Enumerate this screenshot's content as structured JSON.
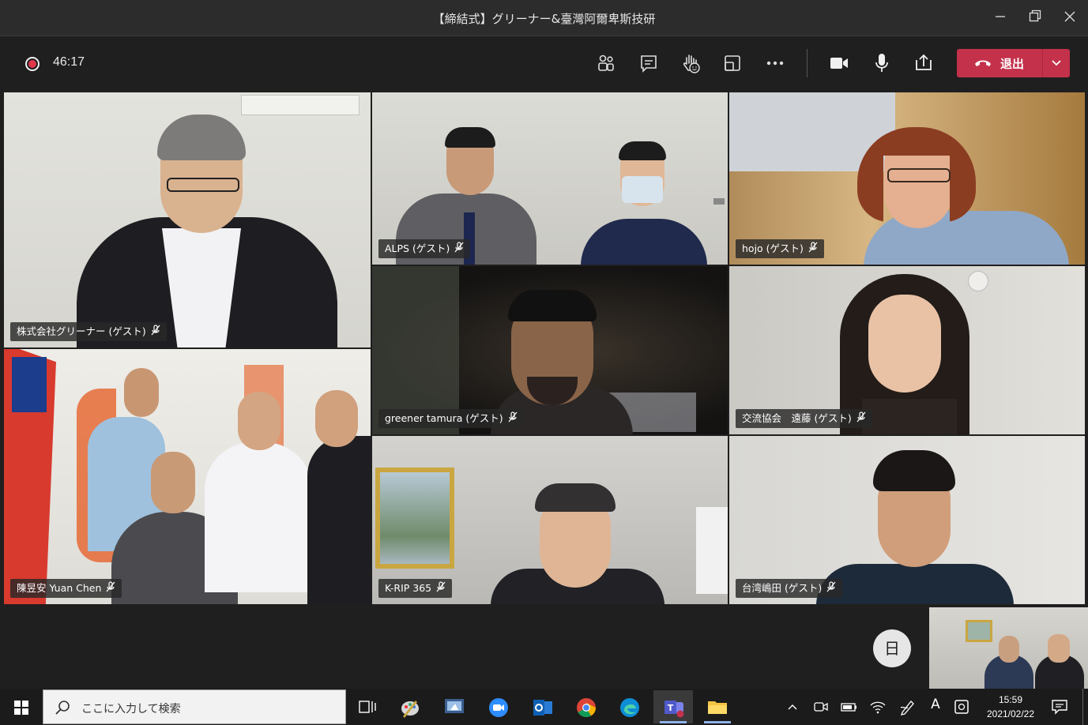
{
  "window": {
    "title": "【締結式】グリーナー&臺灣阿爾卑斯技研",
    "minimize_icon": "minimize-icon",
    "restore_icon": "restore-icon",
    "close_icon": "close-icon"
  },
  "toolbar": {
    "recording_time": "46:17",
    "leave_label": "退出",
    "leave_color": "#c4314b"
  },
  "participants": [
    {
      "name": "株式会社グリーナー (ゲスト)"
    },
    {
      "name": "ALPS (ゲスト)"
    },
    {
      "name": "hojo (ゲスト)"
    },
    {
      "name": "陳昱安 Yuan Chen"
    },
    {
      "name": "greener tamura (ゲスト)"
    },
    {
      "name": "交流協会　遠藤 (ゲスト)"
    },
    {
      "name": "K-RIP 365"
    },
    {
      "name": "台湾嶋田 (ゲスト)"
    }
  ],
  "day_button_label": "日",
  "taskbar": {
    "search_placeholder": "ここに入力して検索",
    "ime_label": "A",
    "time": "15:59",
    "date": "2021/02/22"
  }
}
